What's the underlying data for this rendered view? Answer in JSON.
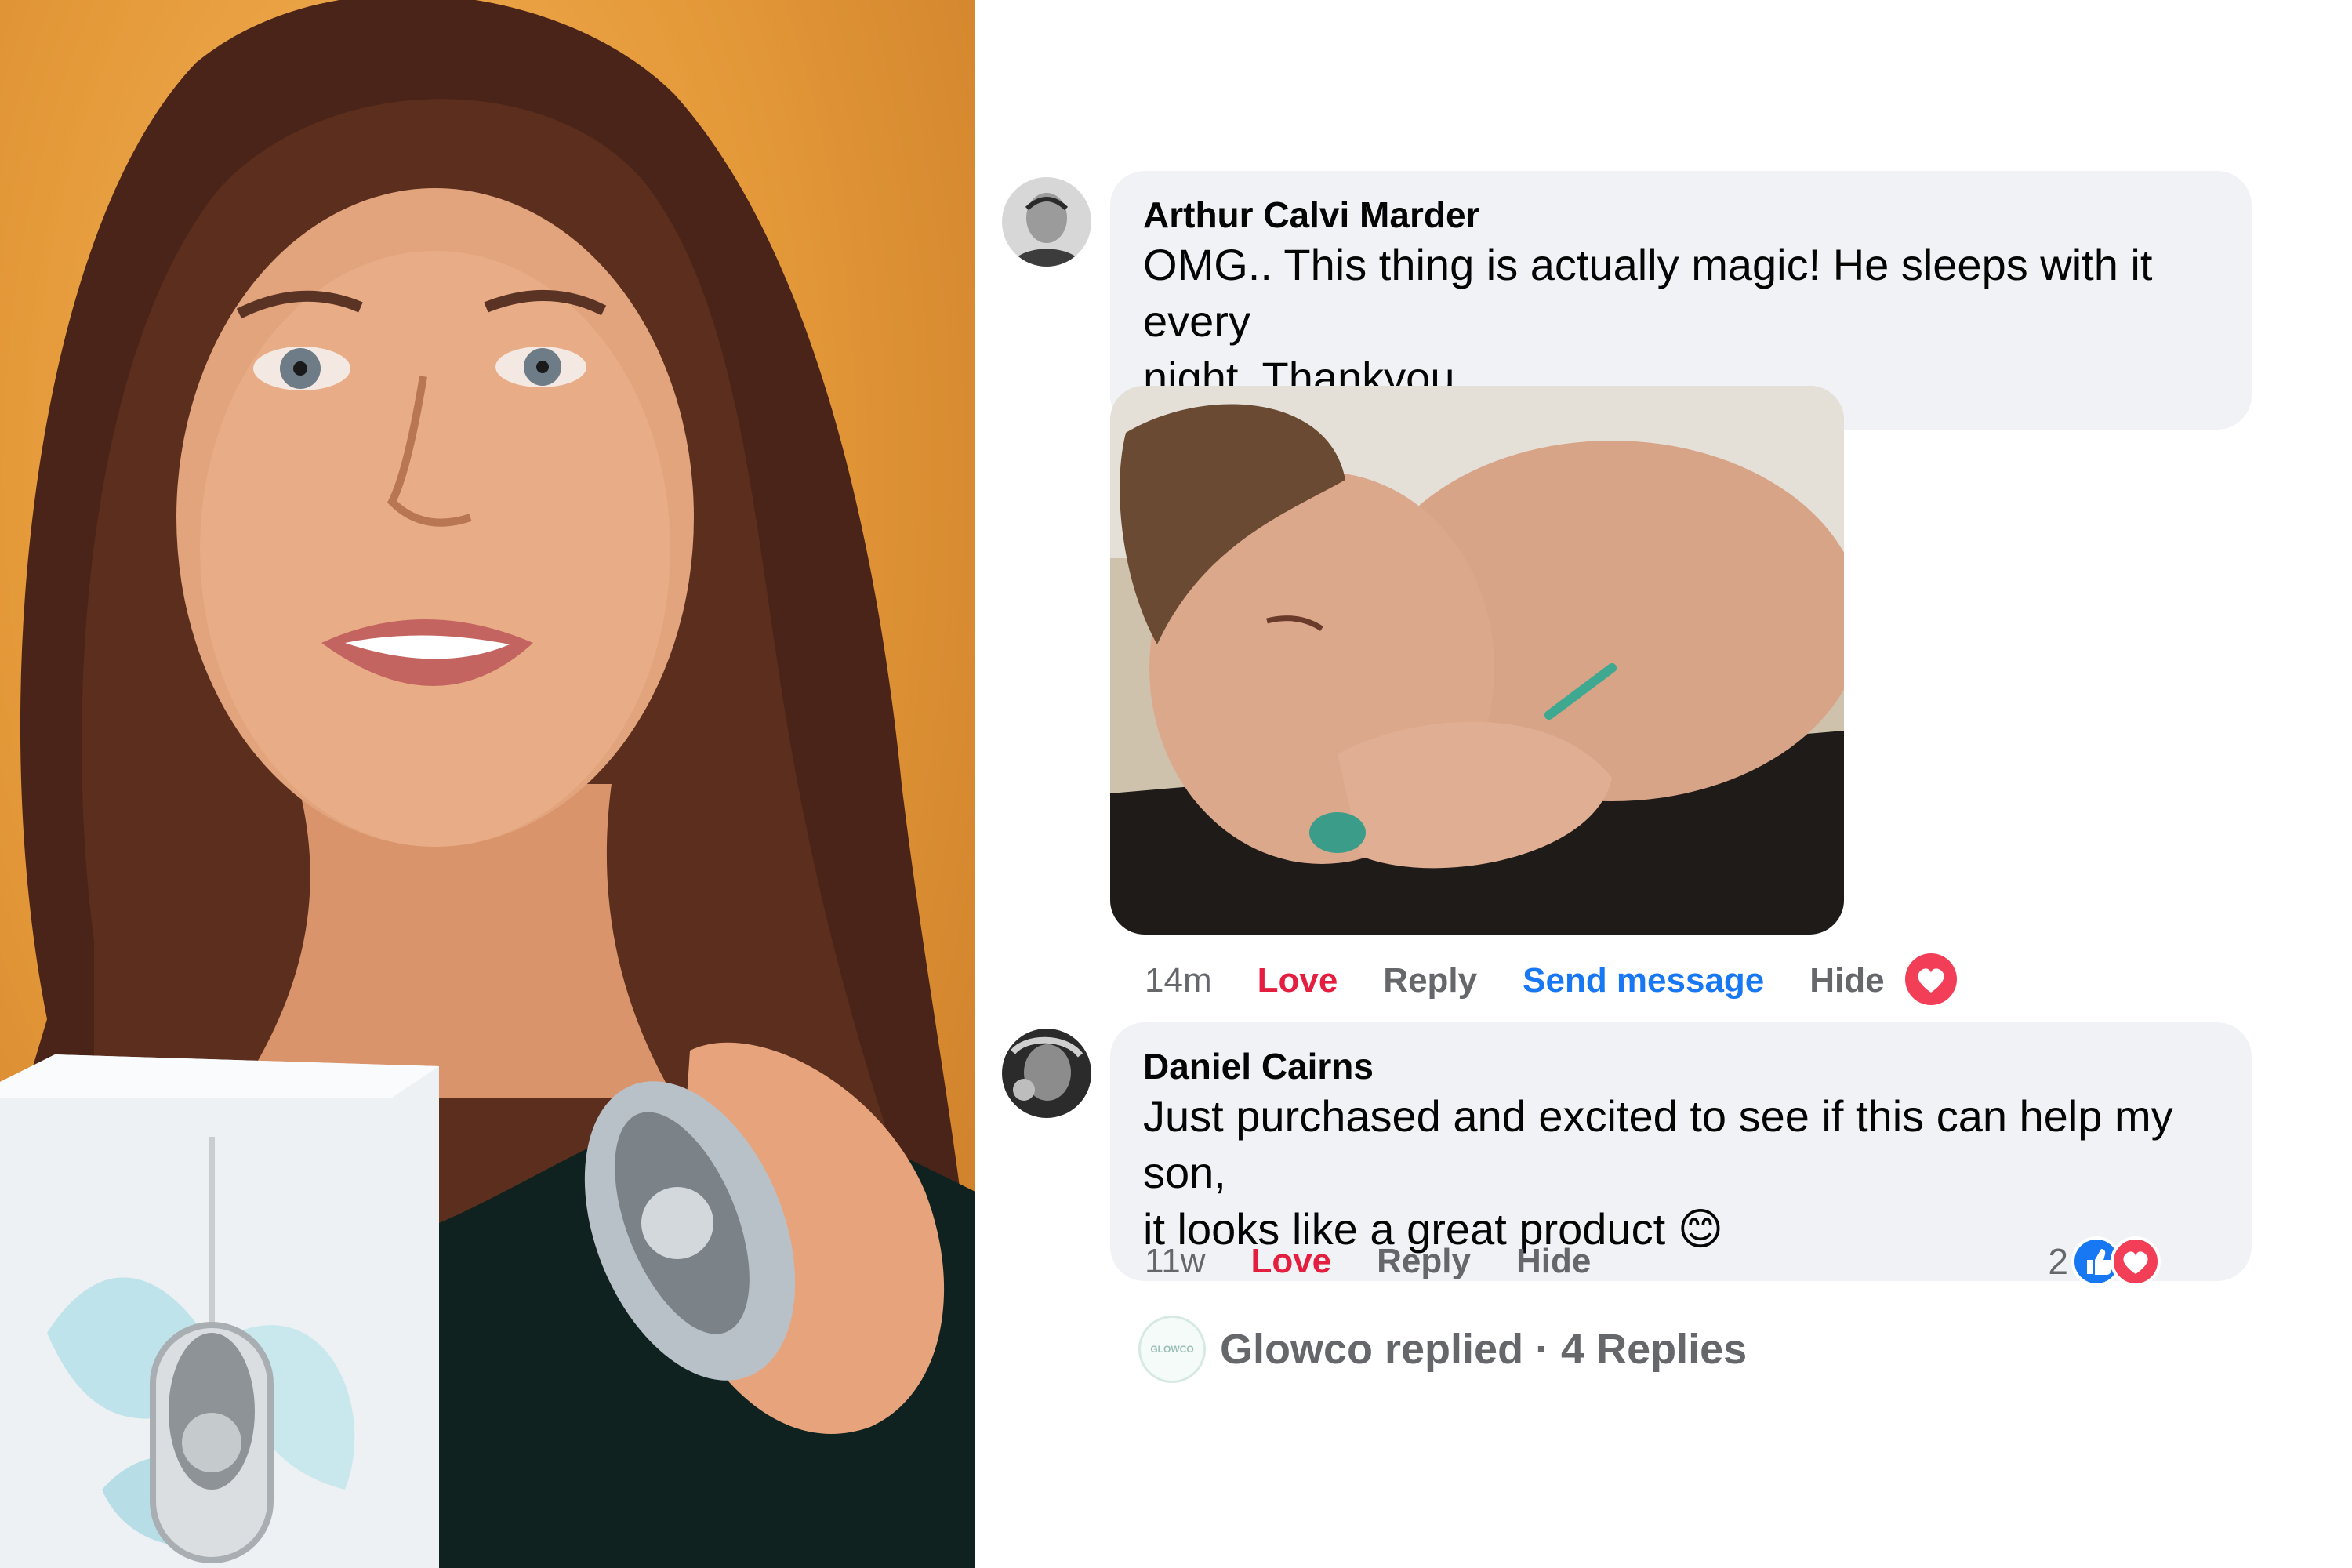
{
  "colors": {
    "love": "#e41e3f",
    "link": "#1877f2",
    "muted": "#65676b",
    "bubble": "#f0f2f5"
  },
  "comments": [
    {
      "author": "Arthur Calvi Marder",
      "text_line1": "OMG.. This thing is actually magic! He sleeps with it every",
      "text_line2": "night. Thankyou",
      "time": "14m",
      "love": "Love",
      "reply": "Reply",
      "send_message": "Send message",
      "hide": "Hide",
      "reaction_icon": "heart-icon"
    },
    {
      "author": "Daniel Cairns",
      "text_line1": "Just purchased and excited to see if this can help my son,",
      "text_line2": "it looks like a great product",
      "emoji": "😊",
      "time": "11w",
      "love": "Love",
      "reply": "Reply",
      "hide": "Hide",
      "reaction_count": "2",
      "reaction_icons": [
        "like-icon",
        "heart-icon"
      ]
    }
  ],
  "replies": {
    "avatar_text": "GLOWCO",
    "label": "Glowco replied · 4 Replies"
  }
}
